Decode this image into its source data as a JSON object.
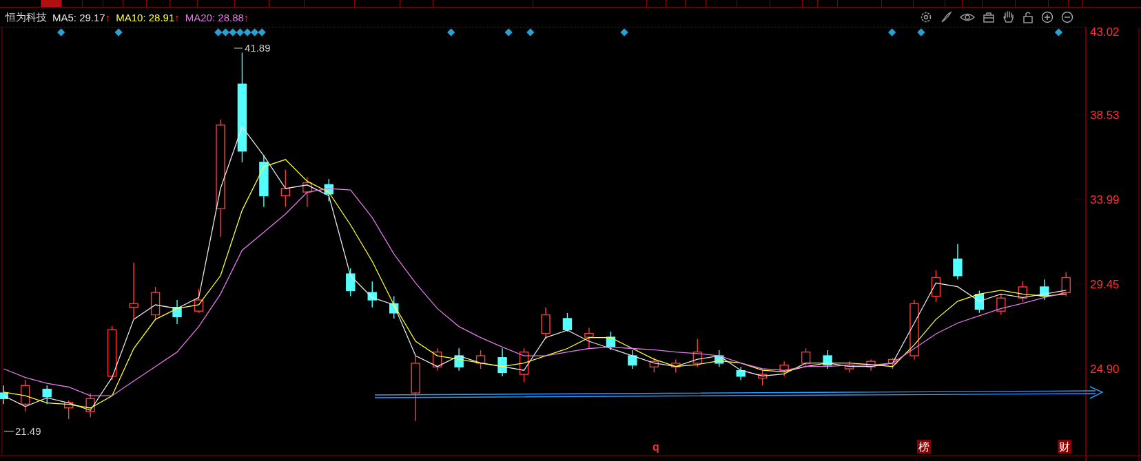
{
  "tabs": [
    {
      "selected": false
    },
    {
      "selected": true
    },
    {
      "selected": false
    },
    {
      "selected": false
    },
    {
      "selected": false
    },
    {
      "selected": false
    },
    {
      "selected": false
    },
    {
      "selected": false
    },
    {
      "selected": false
    },
    {
      "selected": false
    },
    {
      "selected": false
    },
    {
      "selected": false
    },
    {
      "selected": false
    },
    {
      "selected": false
    },
    {
      "selected": false
    },
    {
      "selected": false
    },
    {
      "selected": false
    },
    {
      "selected": false
    },
    {
      "selected": false
    },
    {
      "selected": false
    },
    {
      "selected": false
    },
    {
      "selected": false
    },
    {
      "selected": false
    },
    {
      "selected": false
    },
    {
      "selected": false
    },
    {
      "selected": false
    },
    {
      "selected": false
    },
    {
      "selected": false
    },
    {
      "selected": false
    },
    {
      "selected": false
    },
    {
      "selected": false
    },
    {
      "selected": false
    },
    {
      "selected": false
    }
  ],
  "legend": {
    "name": "恒为科技",
    "averages": [
      {
        "label": "MA5: 29.17",
        "arrow": "↑"
      },
      {
        "label": "MA10: 28.91",
        "arrow": "↑"
      },
      {
        "label": "MA20: 28.88",
        "arrow": "↑"
      }
    ]
  },
  "chart_data": {
    "type": "candlestick",
    "ylim": [
      20.24,
      43.39
    ],
    "yticks": [
      {
        "value": 43.02,
        "label": "43.02"
      },
      {
        "value": 38.53,
        "label": "38.53"
      },
      {
        "value": 33.99,
        "label": "33.99"
      },
      {
        "value": 29.45,
        "label": "29.45"
      },
      {
        "value": 24.9,
        "label": "24.90"
      }
    ],
    "ohlc": [
      [
        23.6,
        24.0,
        23.0,
        23.3
      ],
      [
        23.0,
        24.3,
        22.6,
        24.0
      ],
      [
        23.8,
        24.0,
        23.0,
        23.4
      ],
      [
        22.8,
        23.2,
        22.2,
        23.1
      ],
      [
        22.6,
        23.6,
        22.3,
        23.3
      ],
      [
        24.5,
        27.2,
        24.3,
        27.0
      ],
      [
        28.2,
        30.6,
        27.6,
        28.4
      ],
      [
        27.8,
        29.3,
        27.5,
        29.0
      ],
      [
        28.2,
        28.6,
        27.3,
        27.7
      ],
      [
        28.0,
        29.2,
        27.9,
        28.6
      ],
      [
        33.5,
        38.3,
        32.0,
        38.0
      ],
      [
        40.2,
        41.89,
        36.0,
        36.6
      ],
      [
        36.0,
        36.4,
        33.6,
        34.2
      ],
      [
        34.2,
        35.6,
        33.6,
        34.6
      ],
      [
        34.4,
        35.2,
        33.6,
        34.9
      ],
      [
        34.8,
        35.1,
        33.9,
        34.3
      ],
      [
        30.0,
        30.3,
        28.8,
        29.1
      ],
      [
        29.0,
        29.6,
        28.2,
        28.6
      ],
      [
        28.4,
        28.8,
        27.6,
        27.9
      ],
      [
        23.6,
        25.6,
        22.1,
        25.2
      ],
      [
        25.0,
        26.0,
        24.8,
        25.8
      ],
      [
        25.6,
        26.0,
        24.8,
        25.0
      ],
      [
        25.2,
        25.9,
        24.9,
        25.6
      ],
      [
        25.5,
        26.0,
        24.5,
        24.7
      ],
      [
        24.6,
        26.0,
        24.2,
        25.8
      ],
      [
        26.8,
        28.2,
        26.5,
        27.8
      ],
      [
        27.6,
        27.9,
        26.9,
        27.0
      ],
      [
        26.6,
        27.1,
        26.0,
        26.8
      ],
      [
        26.6,
        26.9,
        25.9,
        26.1
      ],
      [
        25.6,
        25.9,
        24.9,
        25.1
      ],
      [
        25.0,
        25.5,
        24.7,
        25.3
      ],
      [
        25.0,
        25.4,
        24.7,
        25.2
      ],
      [
        25.2,
        26.5,
        25.0,
        25.8
      ],
      [
        25.6,
        25.9,
        25.0,
        25.2
      ],
      [
        24.8,
        25.0,
        24.3,
        24.5
      ],
      [
        24.4,
        24.8,
        24.0,
        24.6
      ],
      [
        24.8,
        25.3,
        24.5,
        25.1
      ],
      [
        25.2,
        26.0,
        25.0,
        25.8
      ],
      [
        25.6,
        25.9,
        24.9,
        25.1
      ],
      [
        24.9,
        25.3,
        24.7,
        25.1
      ],
      [
        25.0,
        25.4,
        24.8,
        25.3
      ],
      [
        25.2,
        25.5,
        24.9,
        25.4
      ],
      [
        25.6,
        28.6,
        25.4,
        28.4
      ],
      [
        28.8,
        30.2,
        28.5,
        29.8
      ],
      [
        30.8,
        31.6,
        29.7,
        29.9
      ],
      [
        28.9,
        29.1,
        27.9,
        28.1
      ],
      [
        28.0,
        28.9,
        27.8,
        28.7
      ],
      [
        28.7,
        29.6,
        28.5,
        29.3
      ],
      [
        29.3,
        29.7,
        28.6,
        28.8
      ],
      [
        29.0,
        30.1,
        28.8,
        29.8
      ]
    ],
    "series": [
      {
        "type": "line",
        "color": "#e6e6e6",
        "values": [
          23.45,
          22.87,
          23.34,
          23.06,
          22.67,
          24.43,
          27.56,
          28.34,
          28.14,
          28.73,
          34.59,
          37.91,
          36.35,
          34.59,
          34.78,
          34.2,
          29.9,
          28.73,
          28.34,
          25.6,
          25.02,
          25.6,
          25.21,
          25.02,
          24.82,
          26.58,
          26.97,
          26.38,
          25.99,
          25.6,
          25.21,
          25.02,
          25.41,
          25.6,
          24.82,
          24.51,
          24.63,
          25.21,
          25.21,
          25.02,
          25.02,
          25.21,
          27.36,
          29.51,
          29.31,
          28.53,
          28.92,
          28.73,
          28.92,
          29.12
        ]
      },
      {
        "type": "line",
        "color": "#ffff33",
        "values": [
          23.65,
          23.45,
          23.06,
          22.99,
          22.79,
          23.45,
          25.99,
          27.56,
          28.14,
          28.34,
          29.9,
          33.42,
          35.76,
          36.15,
          34.98,
          34.39,
          32.63,
          30.68,
          28.34,
          26.38,
          25.6,
          25.41,
          25.21,
          25.02,
          25.21,
          25.6,
          25.99,
          26.58,
          26.58,
          25.99,
          25.41,
          25.02,
          25.13,
          25.33,
          25.21,
          24.82,
          24.74,
          25.02,
          25.21,
          25.21,
          25.13,
          25.02,
          26.19,
          27.56,
          28.53,
          28.92,
          29.12,
          28.92,
          28.81,
          28.92
        ]
      },
      {
        "type": "line",
        "color": "#e478e8",
        "values": [
          24.9,
          24.43,
          24.12,
          23.92,
          23.45,
          23.45,
          24.24,
          25.02,
          25.8,
          27.17,
          28.92,
          31.27,
          32.24,
          33.22,
          34.39,
          34.59,
          34.51,
          33.03,
          31.07,
          29.51,
          28.14,
          27.17,
          26.58,
          26.07,
          25.6,
          25.6,
          25.8,
          25.99,
          26.07,
          25.99,
          25.92,
          25.8,
          25.72,
          25.6,
          25.21,
          24.9,
          24.82,
          25.02,
          25.02,
          25.1,
          25.1,
          25.21,
          25.99,
          26.78,
          27.36,
          27.75,
          28.14,
          28.42,
          28.73,
          29.0
        ]
      }
    ]
  },
  "price_labels": [
    {
      "kind": "high",
      "value": "41.89"
    },
    {
      "kind": "low",
      "value": "21.49"
    }
  ],
  "event_tags": [
    {
      "kind": "plain",
      "text": "q"
    },
    {
      "kind": "boxed",
      "text": "榜"
    },
    {
      "kind": "boxed",
      "text": "财"
    }
  ]
}
